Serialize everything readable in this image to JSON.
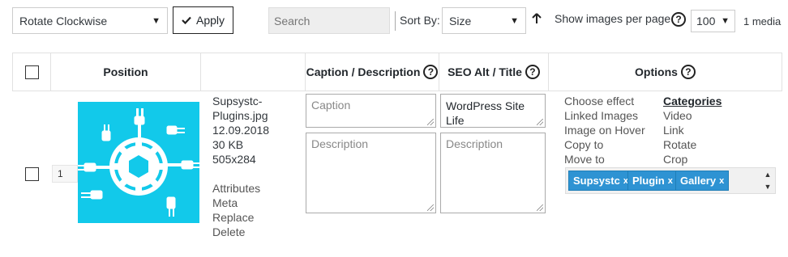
{
  "toolbar": {
    "bulk_action_value": "Rotate Clockwise",
    "apply_label": "Apply",
    "search_placeholder": "Search",
    "sort_by_label": "Sort By:",
    "sort_by_value": "Size",
    "show_images_label": "Show images per page",
    "per_page_value": "100",
    "media_count": "1 media"
  },
  "table": {
    "headers": {
      "position": "Position",
      "caption_description": "Caption / Description",
      "seo_alt_title": "SEO Alt / Title",
      "options": "Options"
    }
  },
  "row": {
    "position_value": "1",
    "file_name": "Supsystc-Plugins.jpg",
    "file_name_line1": "Supsystc-",
    "file_name_line2": "Plugins.jpg",
    "date": "12.09.2018",
    "size": "30 KB",
    "dimensions": "505x284",
    "actions": [
      "Attributes",
      "Meta",
      "Replace",
      "Delete"
    ],
    "caption_placeholder": "Caption",
    "description_placeholder": "Description",
    "seo_alt_value": "WordPress Site Life",
    "seo_description_placeholder": "Description",
    "options_left": [
      "Choose effect",
      "Linked Images",
      "Image on Hover",
      "Copy to",
      "Move to"
    ],
    "options_right": [
      "Categories",
      "Video",
      "Link",
      "Rotate",
      "Crop"
    ],
    "tags": [
      "Supsystc",
      "Plugin",
      "Gallery"
    ],
    "tag_remove": "x"
  },
  "colors": {
    "accent_tag": "#2e93d3",
    "thumbnail_bg": "#12c9ea"
  },
  "icons": {
    "apply": "checkmark-icon",
    "sort_direction": "arrow-up-icon",
    "help": "question-circle-icon"
  }
}
